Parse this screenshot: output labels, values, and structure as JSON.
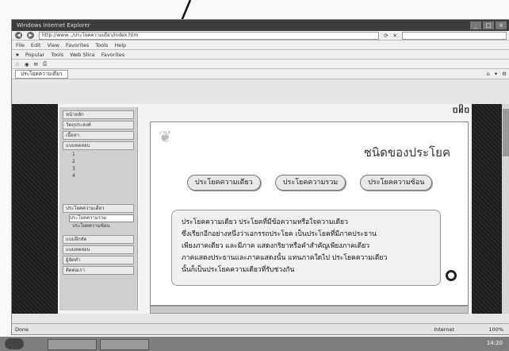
{
  "browser": {
    "title": "Windows Internet Explorer",
    "address": "http://www.../ประโยคความเดียว/index.htm",
    "menu": [
      "File",
      "Edit",
      "View",
      "Favorites",
      "Tools",
      "Help"
    ],
    "toolbar_links": [
      "Popular",
      "Tools",
      "Web Slice",
      "Favorites"
    ],
    "tab_label": "ประโยคความเดียว",
    "status_left": "Done",
    "status_zone": "Internet",
    "status_zoom": "100%"
  },
  "page": {
    "logo_text": "ชนิดของประโยค",
    "title": "ชนิดของประโยค",
    "tabs": [
      "ประโยคความเดียว",
      "ประโยคความรวม",
      "ประโยคความซ้อน"
    ],
    "paragraph": [
      "ประโยคความเดียว ประโยคที่มีข้อความหรือใจความเดียว",
      "ซึ่งเรียกอีกอย่างหนึ่งว่าเอกรรถประโยค เป็นประโยคที่มีภาคประธาน",
      "เพียงภาคเดียว และมีภาค แสดงกริยาหรือคำสำคัญเพียงภาคเดียว",
      "ภาคแสดงประธานและภาคแสดงนั้น แทนภาคใดไป ประโยคความเดียว",
      "นั้นก็เป็นประโยคความเดียวที่รับช่วงกัน"
    ]
  },
  "sidebar": {
    "items": [
      "หน้าหลัก",
      "วัตถุประสงค์",
      "เนื้อหา",
      "แบบทดสอบ"
    ],
    "subitems": [
      "1",
      "2",
      "3",
      "4"
    ],
    "group2": [
      "ประโยคความเดียว",
      "ประโยคความรวม",
      "ประโยคความซ้อน"
    ],
    "group3": [
      "แบบฝึกหัด",
      "แบบทดสอบ",
      "ผู้จัดทำ",
      "ติดต่อเรา"
    ]
  },
  "taskbar": {
    "clock": "14:20"
  }
}
